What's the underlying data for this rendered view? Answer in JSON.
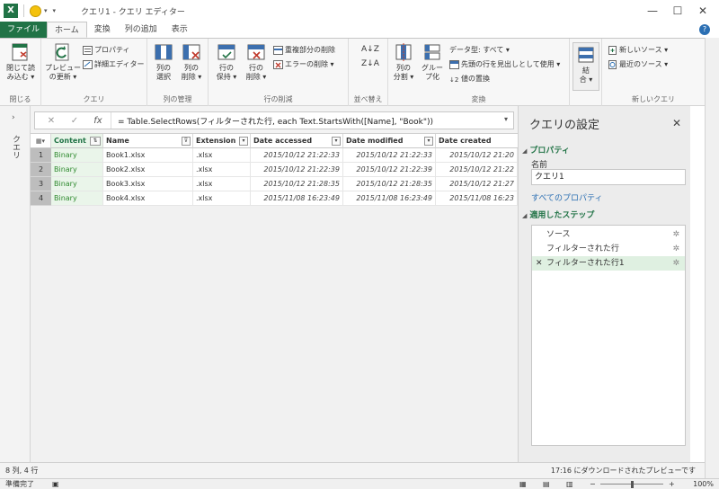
{
  "window": {
    "title": "クエリ1 - クエリ エディター",
    "minimize": "—",
    "maximize": "☐",
    "close": "✕"
  },
  "ribbon_tabs": [
    "ファイル",
    "ホーム",
    "変換",
    "列の追加",
    "表示"
  ],
  "ribbon": {
    "groups": {
      "close": "閉じる",
      "query": "クエリ",
      "manage_cols": "列の管理",
      "reduce_rows": "行の削減",
      "sort": "並べ替え",
      "transform": "変換",
      "new_query": "新しいクエリ"
    },
    "close_load": [
      "閉じて読",
      "み込む ▾"
    ],
    "preview_refresh": [
      "プレビュー",
      "の更新 ▾"
    ],
    "properties": "プロパティ",
    "advanced_editor": "詳細エディター",
    "choose_columns": [
      "列の",
      "選択"
    ],
    "remove_columns": [
      "列の",
      "削除 ▾"
    ],
    "keep_rows": [
      "行の",
      "保持 ▾"
    ],
    "remove_rows": [
      "行の",
      "削除 ▾"
    ],
    "remove_duplicates": "重複部分の削除",
    "remove_errors": "エラーの削除 ▾",
    "split_column": [
      "列の",
      "分割 ▾"
    ],
    "group_by": [
      "グルー",
      "プ化"
    ],
    "data_type": "データ型: すべて ▾",
    "use_first_row": "先頭の行を見出しとして使用 ▾",
    "replace_values": "値の置換",
    "combine": [
      "結",
      "合 ▾"
    ],
    "new_source": "新しいソース ▾",
    "recent_sources": "最近のソース ▾"
  },
  "queries_pane_label": "クエリ",
  "formula": {
    "cancel": "✕",
    "commit": "✓",
    "fx": "fx",
    "text": "= Table.SelectRows(フィルターされた行, each Text.StartsWith([Name], \"Book\"))"
  },
  "table": {
    "columns": [
      "Content",
      "Name",
      "Extension",
      "Date accessed",
      "Date modified",
      "Date created"
    ],
    "rows": [
      [
        "1",
        "Binary",
        "Book1.xlsx",
        ".xlsx",
        "2015/10/12 21:22:33",
        "2015/10/12 21:22:33",
        "2015/10/12 21:20"
      ],
      [
        "2",
        "Binary",
        "Book2.xlsx",
        ".xlsx",
        "2015/10/12 21:22:39",
        "2015/10/12 21:22:39",
        "2015/10/12 21:22"
      ],
      [
        "3",
        "Binary",
        "Book3.xlsx",
        ".xlsx",
        "2015/10/12 21:28:35",
        "2015/10/12 21:28:35",
        "2015/10/12 21:27"
      ],
      [
        "4",
        "Binary",
        "Book4.xlsx",
        ".xlsx",
        "2015/11/08 16:23:49",
        "2015/11/08 16:23:49",
        "2015/11/08 16:23"
      ]
    ]
  },
  "query_settings": {
    "title": "クエリの設定",
    "properties_header": "プロパティ",
    "name_label": "名前",
    "name_value": "クエリ1",
    "all_properties": "すべてのプロパティ",
    "applied_steps_header": "適用したステップ",
    "steps": [
      "ソース",
      "フィルターされた行",
      "フィルターされた行1"
    ]
  },
  "status": {
    "left": "8 列, 4 行",
    "right": "17:16 にダウンロードされたプレビューです"
  },
  "excel_status": {
    "ready": "準備完了",
    "zoom": "100%"
  },
  "colors": {
    "excel_green": "#217346",
    "binary_green": "#2f8a2f",
    "link_blue": "#2b6fb3",
    "selected_step": "#dff0e1"
  }
}
